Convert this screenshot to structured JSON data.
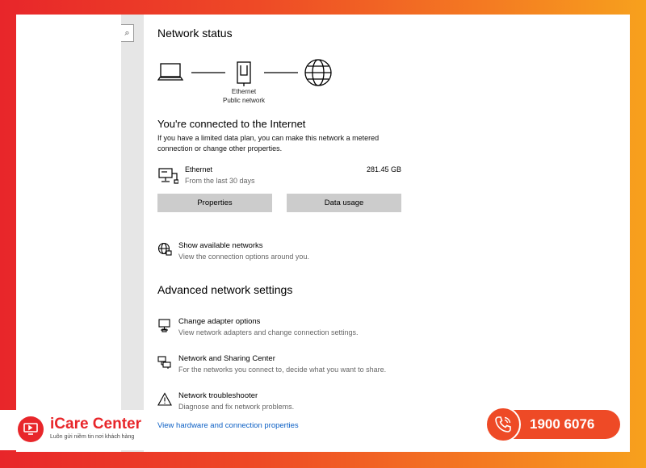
{
  "network_status": {
    "heading": "Network status",
    "ethernet_label": "Ethernet",
    "network_type_label": "Public network"
  },
  "connection": {
    "heading": "You're connected to the Internet",
    "description": "If you have a limited data plan, you can make this network a metered connection or change other properties."
  },
  "ethernet_usage": {
    "name": "Ethernet",
    "period": "From the last 30 days",
    "data_used": "281.45 GB"
  },
  "buttons": {
    "properties": "Properties",
    "data_usage": "Data usage"
  },
  "show_networks": {
    "title": "Show available networks",
    "description": "View the connection options around you."
  },
  "advanced": {
    "heading": "Advanced network settings",
    "items": [
      {
        "title": "Change adapter options",
        "description": "View network adapters and change connection settings."
      },
      {
        "title": "Network and Sharing Center",
        "description": "For the networks you connect to, decide what you want to share."
      },
      {
        "title": "Network troubleshooter",
        "description": "Diagnose and fix network problems."
      }
    ],
    "hardware_link": "View hardware and connection properties"
  },
  "brand": {
    "name": "iCare Center",
    "slogan": "Luôn gửi niềm tin nơi khách hàng",
    "hotline": "1900 6076",
    "accent_color": "#e8262a",
    "secondary_color": "#ee4a26"
  },
  "icons": [
    "search-icon",
    "laptop-icon",
    "router-icon",
    "globe-icon",
    "ethernet-pc-icon",
    "network-globe-icon",
    "adapter-icon",
    "sharing-center-icon",
    "warning-icon",
    "phone-icon"
  ]
}
